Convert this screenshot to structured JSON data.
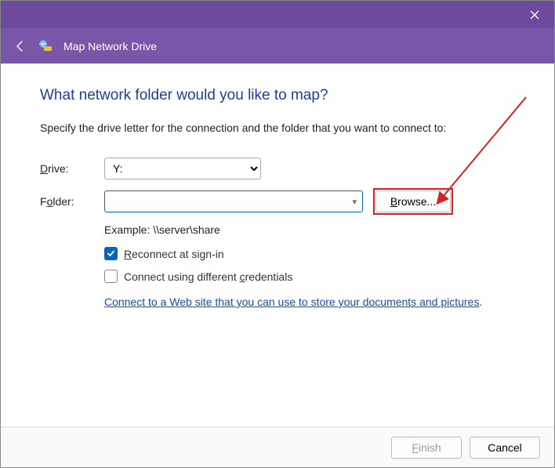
{
  "titlebar": {},
  "subheader": {
    "title": "Map Network Drive"
  },
  "content": {
    "heading": "What network folder would you like to map?",
    "instruction": "Specify the drive letter for the connection and the folder that you want to connect to:",
    "drive_label": "Drive:",
    "drive_value": "Y:",
    "folder_label": "Folder:",
    "folder_value": "",
    "browse_label": "Browse...",
    "example": "Example: \\\\server\\share",
    "reconnect_label": "Reconnect at sign-in",
    "reconnect_checked": true,
    "credentials_label": "Connect using different credentials",
    "credentials_checked": false,
    "link_text": "Connect to a Web site that you can use to store your documents and pictures",
    "link_suffix": "."
  },
  "footer": {
    "finish_label": "Finish",
    "cancel_label": "Cancel"
  },
  "annotation": {
    "highlight_browse": true,
    "arrow_color": "#d92020"
  }
}
